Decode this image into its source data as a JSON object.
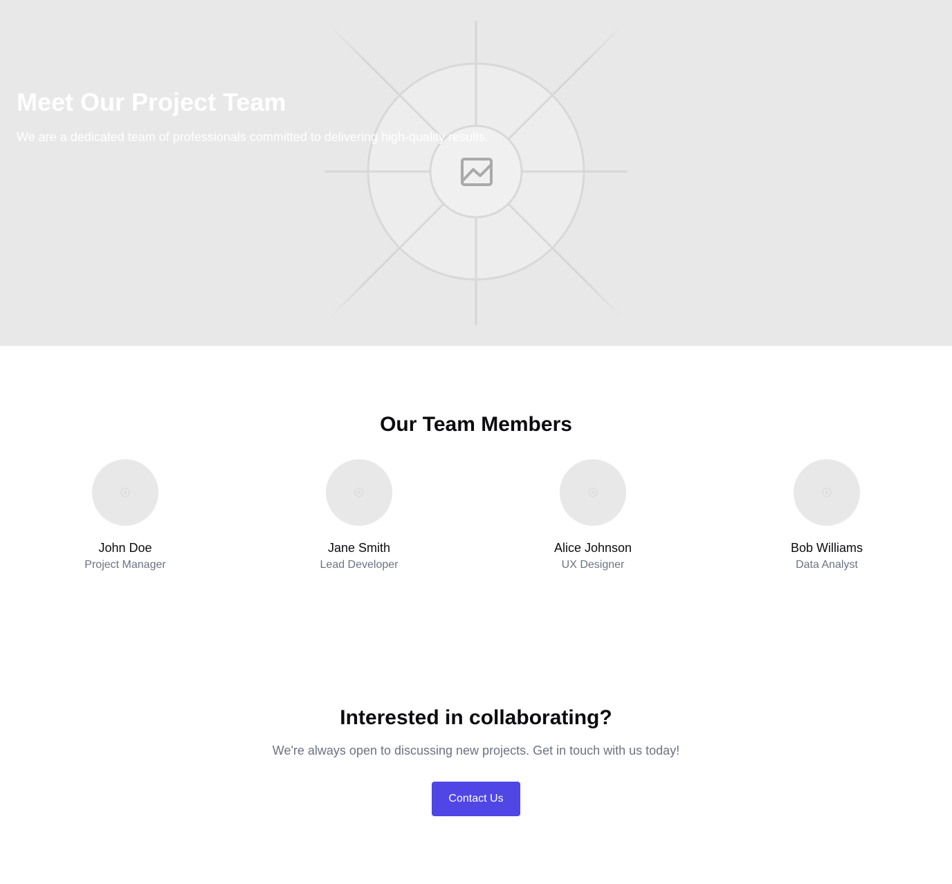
{
  "hero": {
    "title": "Meet Our Project Team",
    "subtitle": "We are a dedicated team of professionals committed to delivering high-quality results.",
    "image_icon": "image-placeholder-icon"
  },
  "team": {
    "heading": "Our Team Members",
    "members": [
      {
        "name": "John Doe",
        "role": "Project Manager"
      },
      {
        "name": "Jane Smith",
        "role": "Lead Developer"
      },
      {
        "name": "Alice Johnson",
        "role": "UX Designer"
      },
      {
        "name": "Bob Williams",
        "role": "Data Analyst"
      }
    ]
  },
  "cta": {
    "heading": "Interested in collaborating?",
    "text": "We're always open to discussing new projects. Get in touch with us today!",
    "button_label": "Contact Us"
  },
  "colors": {
    "accent": "#4f46e5",
    "placeholder_bg": "#e8e8e8",
    "muted_text": "#6b7280"
  }
}
